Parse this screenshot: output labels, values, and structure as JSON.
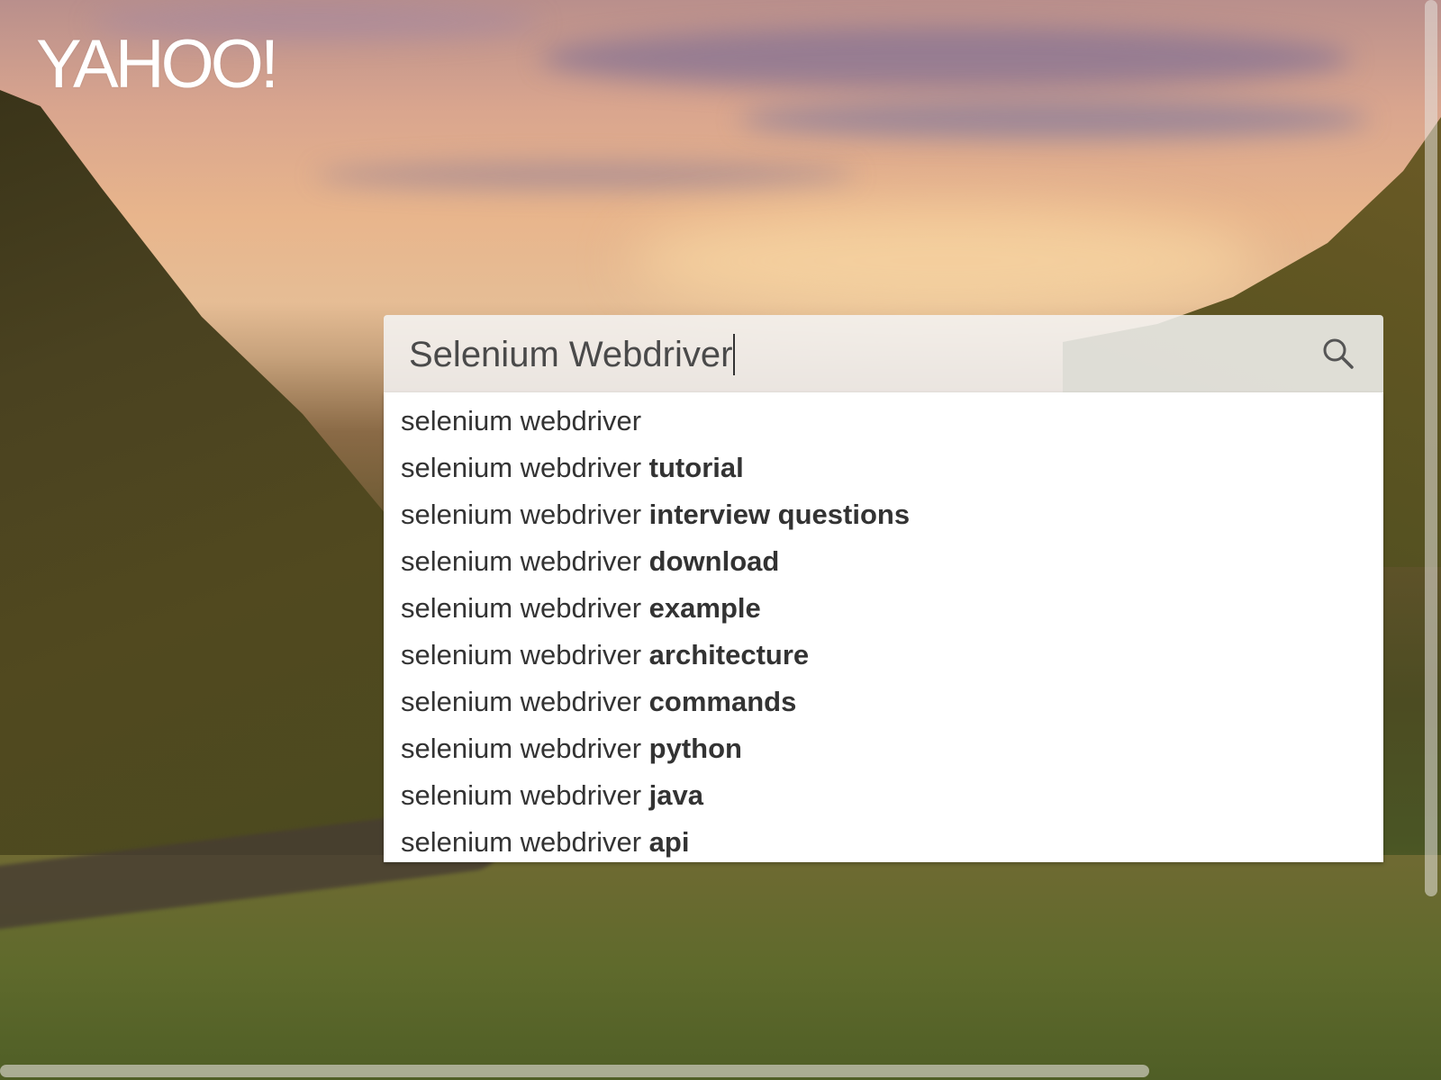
{
  "logo": {
    "text": "YAHOO!"
  },
  "search": {
    "value": "Selenium Webdriver",
    "button_icon": "search-icon"
  },
  "suggestions": [
    {
      "prefix": "selenium webdriver",
      "suffix": ""
    },
    {
      "prefix": "selenium webdriver ",
      "suffix": "tutorial"
    },
    {
      "prefix": "selenium webdriver ",
      "suffix": "interview questions"
    },
    {
      "prefix": "selenium webdriver ",
      "suffix": "download"
    },
    {
      "prefix": "selenium webdriver ",
      "suffix": "example"
    },
    {
      "prefix": "selenium webdriver ",
      "suffix": "architecture"
    },
    {
      "prefix": "selenium webdriver ",
      "suffix": "commands"
    },
    {
      "prefix": "selenium webdriver ",
      "suffix": "python"
    },
    {
      "prefix": "selenium webdriver ",
      "suffix": "java"
    },
    {
      "prefix": "selenium webdriver ",
      "suffix": "api"
    }
  ],
  "colors": {
    "logo": "#ffffff",
    "suggestion_text": "#333333",
    "search_text": "#4a4a4a"
  }
}
